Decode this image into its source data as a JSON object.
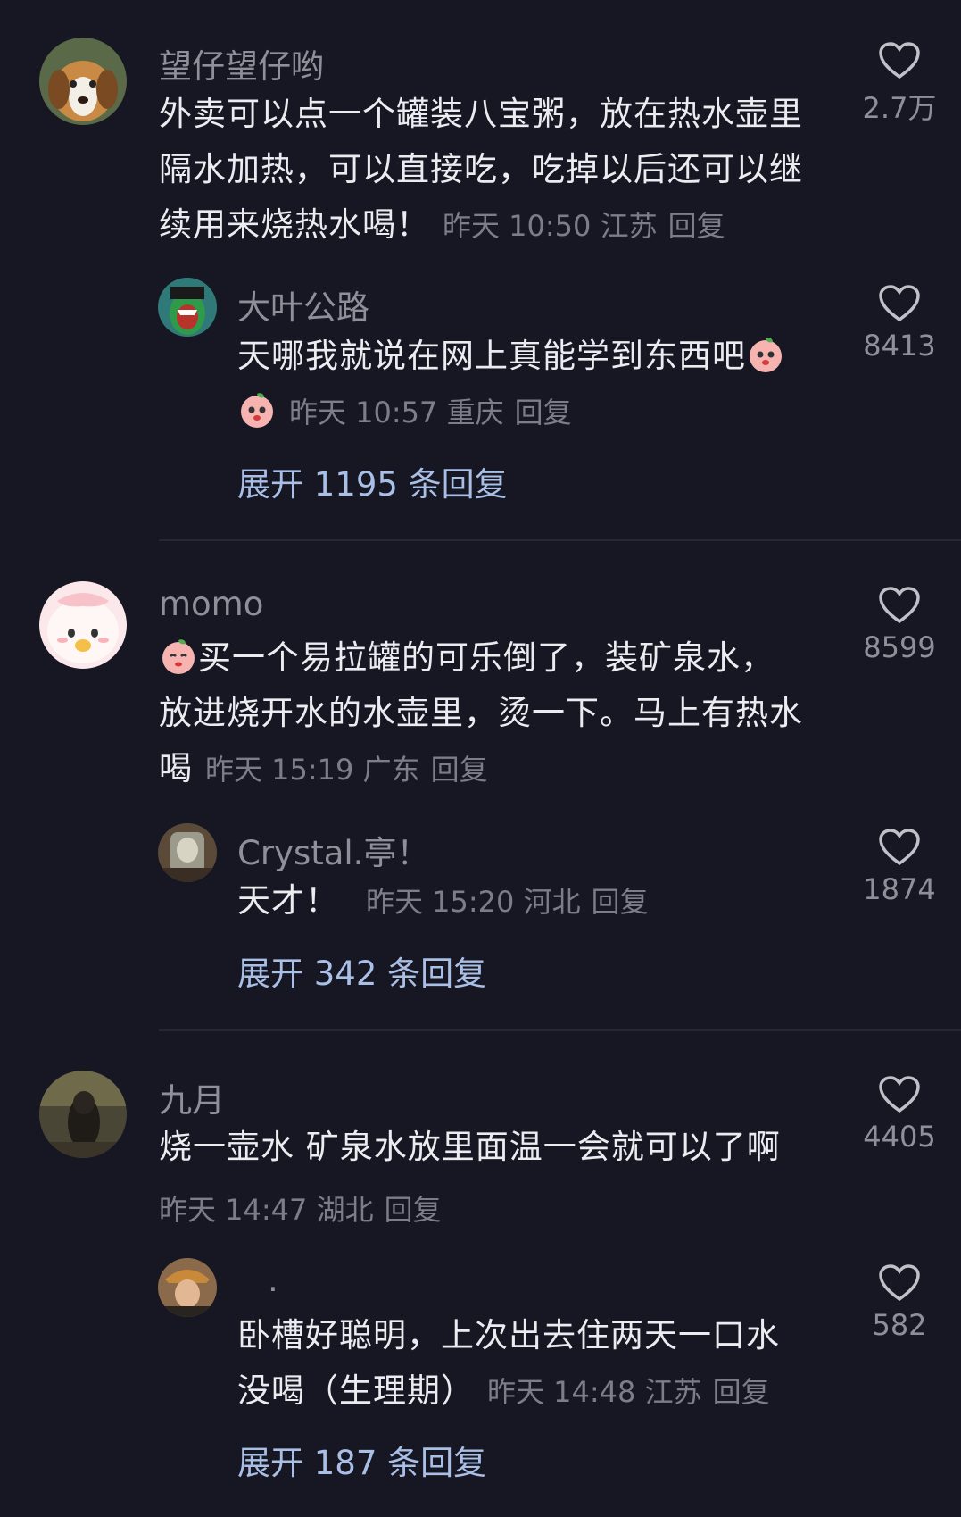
{
  "comments": [
    {
      "user": "望仔望仔哟",
      "text_lines": [
        "外卖可以点一个罐装八宝粥，放在热水壶里",
        "隔水加热，可以直接吃，吃掉以后还可以继",
        "续用来烧热水喝！"
      ],
      "time": "昨天 10:50",
      "location": "江苏",
      "reply_label": "回复",
      "likes": "2.7万",
      "reply": {
        "user": "大叶公路",
        "text_lines": [
          "天哪我就说在网上真能学到东西吧"
        ],
        "time": "昨天 10:57",
        "location": "重庆",
        "reply_label": "回复",
        "likes": "8413"
      },
      "expand": "展开 1195 条回复"
    },
    {
      "user": "momo",
      "text_lines": [
        "买一个易拉罐的可乐倒了，装矿泉水，",
        "放进烧开水的水壶里，烫一下。马上有热水",
        "喝"
      ],
      "time": "昨天 15:19",
      "location": "广东",
      "reply_label": "回复",
      "likes": "8599",
      "reply": {
        "user": "Crystal.亭！",
        "text_lines": [
          "天才！"
        ],
        "time": "昨天 15:20",
        "location": "河北",
        "reply_label": "回复",
        "likes": "1874"
      },
      "expand": "展开 342 条回复"
    },
    {
      "user": "九月",
      "text_lines": [
        "烧一壶水 矿泉水放里面温一会就可以了啊"
      ],
      "time": "昨天 14:47",
      "location": "湖北",
      "reply_label": "回复",
      "likes": "4405",
      "reply": {
        "user": ".",
        "text_lines": [
          "卧槽好聪明，上次出去住两天一口水",
          "没喝（生理期）"
        ],
        "time": "昨天 14:48",
        "location": "江苏",
        "reply_label": "回复",
        "likes": "582"
      },
      "expand": "展开 187 条回复"
    }
  ],
  "icons": {
    "like": "heart-outline-icon",
    "emoji": "peach-face-emoji"
  },
  "colors": {
    "background": "#161722",
    "link": "#a9bfe6",
    "muted": "#7c7d88"
  }
}
